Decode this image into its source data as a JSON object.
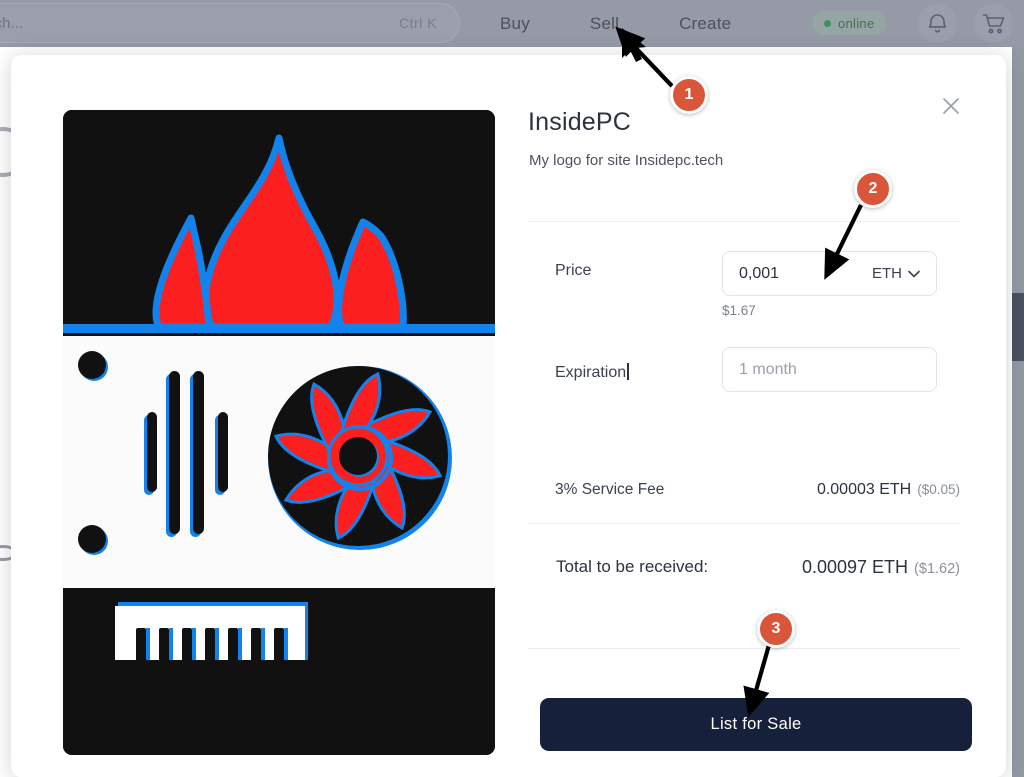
{
  "topbar": {
    "search": {
      "placeholder": "Search...",
      "shortcut": "Ctrl K"
    },
    "nav": [
      {
        "label": "Buy",
        "name": "nav-buy"
      },
      {
        "label": "Sell",
        "name": "nav-sell"
      },
      {
        "label": "Create",
        "name": "nav-create"
      }
    ],
    "status_badge": {
      "label": "online",
      "dot_color": "#3f8f63"
    },
    "icons": [
      {
        "name": "bell-icon",
        "label": "Notifications"
      },
      {
        "name": "cart-icon",
        "label": "Cart"
      }
    ]
  },
  "modal": {
    "close_label": "×",
    "title": "InsidePC",
    "subtitle": "My logo for site Insidepc.tech",
    "price": {
      "label": "Price",
      "value": "0,001",
      "currency": "ETH",
      "usd_note": "$1.67"
    },
    "expiration": {
      "label": "Expiration",
      "placeholder": "1 month"
    },
    "service_fee": {
      "label": "3% Service Fee",
      "amount": "0.00003 ETH",
      "usd": "($0.05)"
    },
    "total": {
      "label": "Total to be received:",
      "amount": "0.00097 ETH",
      "usd": "($1.62)"
    },
    "submit_label": "List for Sale"
  },
  "annotations": {
    "markers": [
      {
        "id": "1",
        "target": "nav-sell"
      },
      {
        "id": "2",
        "target": "price-field"
      },
      {
        "id": "3",
        "target": "list-for-sale-button"
      }
    ]
  },
  "colors": {
    "topbar": "#959aa6",
    "accent_marker": "#d9563a",
    "button": "#17203a",
    "art_red": "#fb1f20",
    "art_blue": "#1283ec",
    "art_black": "#111111"
  }
}
